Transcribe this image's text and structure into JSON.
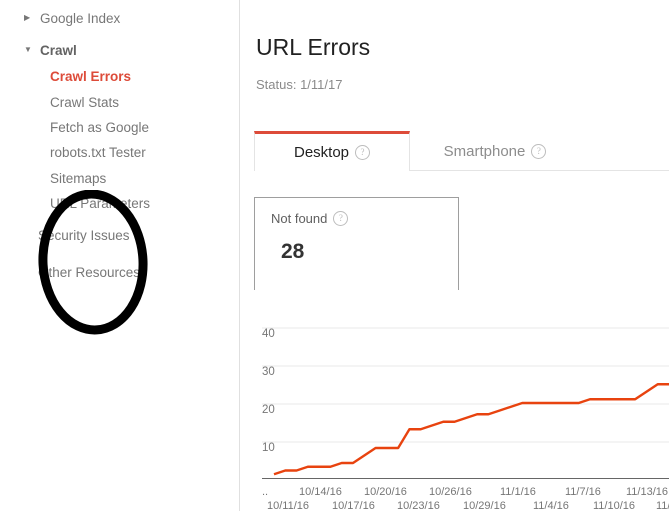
{
  "sidebar": {
    "items": [
      {
        "label": "Google Index",
        "icon": "triangle-right-icon",
        "type": "group-collapsed",
        "expanded": false
      },
      {
        "label": "Crawl",
        "icon": "triangle-down-icon",
        "type": "group-expanded",
        "expanded": true
      },
      {
        "label": "Crawl Errors",
        "type": "sub",
        "active": true
      },
      {
        "label": "Crawl Stats",
        "type": "sub",
        "active": false
      },
      {
        "label": "Fetch as Google",
        "type": "sub",
        "active": false
      },
      {
        "label": "robots.txt Tester",
        "type": "sub",
        "active": false
      },
      {
        "label": "Sitemaps",
        "type": "sub",
        "active": false
      },
      {
        "label": "URL Parameters",
        "type": "sub",
        "active": false
      },
      {
        "label": "Security Issues",
        "type": "plain",
        "active": false
      },
      {
        "label": "Other Resources",
        "type": "plain",
        "active": false
      }
    ],
    "active_color": "#dd4b39"
  },
  "main": {
    "title": "URL Errors",
    "status": "Status: 1/11/17",
    "tabs": [
      {
        "label": "Desktop",
        "help": "?",
        "active": true
      },
      {
        "label": "Smartphone",
        "help": "?",
        "active": false
      }
    ],
    "active_tab_indicator_color": "#dd4b39"
  },
  "error_card": {
    "label": "Not found",
    "help": "?",
    "value": "28"
  },
  "annotation": {
    "type": "hand-drawn-ellipse",
    "color": "#000000",
    "target": "not-found-error-card"
  },
  "chart_data": {
    "type": "line",
    "title": "",
    "xlabel": "",
    "ylabel": "",
    "line_color": "#e8430f",
    "grid": true,
    "legend": "none",
    "ylim": [
      0,
      40
    ],
    "yticks": [
      10,
      20,
      30,
      40
    ],
    "x_axis_leading_marker": "..",
    "x_truncated_last_label": "11/",
    "xtick_labels_row_top": [
      "10/14/16",
      "10/20/16",
      "10/26/16",
      "11/1/16",
      "11/7/16",
      "11/13/16"
    ],
    "xtick_labels_row_bottom": [
      "10/11/16",
      "10/17/16",
      "10/23/16",
      "10/29/16",
      "11/4/16",
      "11/10/16",
      "11/"
    ],
    "x": [
      "10/10/16",
      "10/11/16",
      "10/12/16",
      "10/13/16",
      "10/14/16",
      "10/15/16",
      "10/16/16",
      "10/17/16",
      "10/18/16",
      "10/19/16",
      "10/20/16",
      "10/21/16",
      "10/22/16",
      "10/23/16",
      "10/24/16",
      "10/25/16",
      "10/26/16",
      "10/27/16",
      "10/28/16",
      "10/29/16",
      "10/30/16",
      "10/31/16",
      "11/1/16",
      "11/2/16",
      "11/3/16",
      "11/4/16",
      "11/5/16",
      "11/6/16",
      "11/7/16",
      "11/8/16",
      "11/9/16",
      "11/10/16",
      "11/11/16",
      "11/12/16",
      "11/13/16",
      "11/14/16"
    ],
    "values": [
      1,
      2,
      2,
      3,
      3,
      3,
      4,
      4,
      6,
      8,
      8,
      8,
      13,
      13,
      14,
      15,
      15,
      16,
      17,
      17,
      18,
      19,
      20,
      20,
      20,
      20,
      20,
      20,
      21,
      21,
      21,
      21,
      21,
      23,
      25,
      25
    ]
  }
}
